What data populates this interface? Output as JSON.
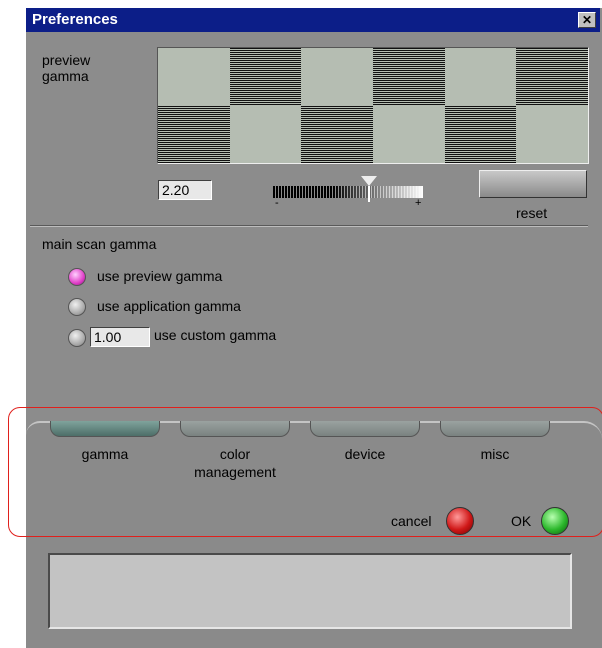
{
  "window": {
    "title": "Preferences",
    "close_symbol": "✕"
  },
  "preview": {
    "label_line1": "preview",
    "label_line2": "gamma",
    "gamma_value": "2.20",
    "minus": "-",
    "plus": "+",
    "reset_label": "reset"
  },
  "main_scan": {
    "label": "main scan gamma",
    "options": [
      {
        "label": "use preview gamma",
        "selected": true
      },
      {
        "label": "use application gamma",
        "selected": false
      },
      {
        "label": "use custom gamma",
        "selected": false
      }
    ],
    "custom_value": "1.00"
  },
  "tabs": [
    {
      "label_line1": "gamma",
      "label_line2": "",
      "active": true
    },
    {
      "label_line1": "color",
      "label_line2": "management",
      "active": false
    },
    {
      "label_line1": "device",
      "label_line2": "",
      "active": false
    },
    {
      "label_line1": "misc",
      "label_line2": "",
      "active": false
    }
  ],
  "actions": {
    "cancel_label": "cancel",
    "ok_label": "OK"
  },
  "colors": {
    "title_bar": "#0c1e88",
    "panel": "#8c8c8c",
    "highlight": "#e0201c"
  }
}
